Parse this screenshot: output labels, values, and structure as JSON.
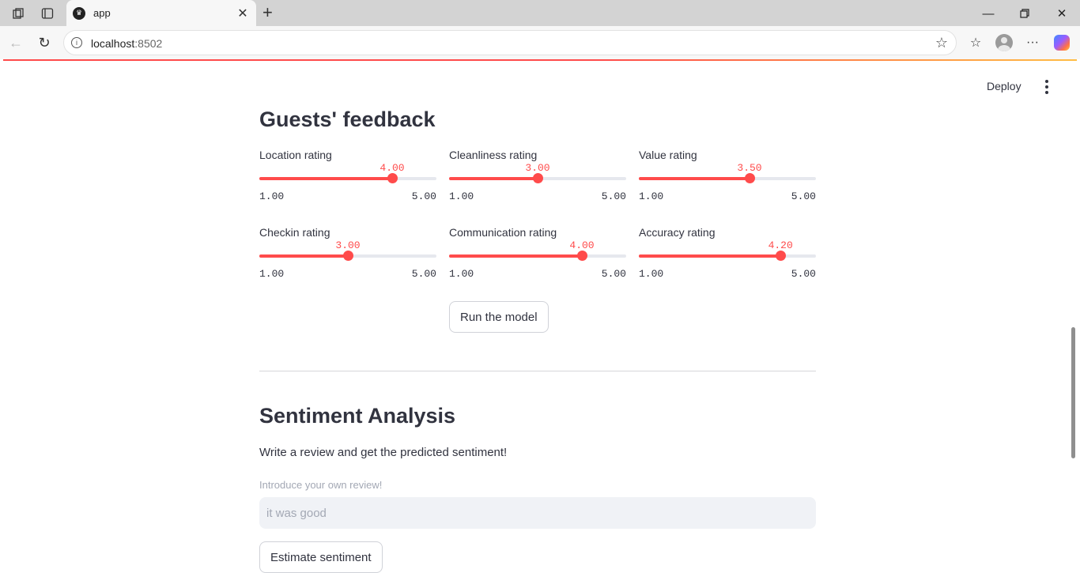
{
  "browser": {
    "tab_title": "app",
    "url_host": "localhost",
    "url_port": ":8502"
  },
  "header": {
    "deploy_label": "Deploy"
  },
  "feedback": {
    "title": "Guests' feedback",
    "sliders": [
      {
        "label": "Location rating",
        "value": "4.00",
        "min": "1.00",
        "max": "5.00",
        "fraction": 0.75
      },
      {
        "label": "Cleanliness rating",
        "value": "3.00",
        "min": "1.00",
        "max": "5.00",
        "fraction": 0.5
      },
      {
        "label": "Value rating",
        "value": "3.50",
        "min": "1.00",
        "max": "5.00",
        "fraction": 0.625
      },
      {
        "label": "Checkin rating",
        "value": "3.00",
        "min": "1.00",
        "max": "5.00",
        "fraction": 0.5
      },
      {
        "label": "Communication rating",
        "value": "4.00",
        "min": "1.00",
        "max": "5.00",
        "fraction": 0.75
      },
      {
        "label": "Accuracy rating",
        "value": "4.20",
        "min": "1.00",
        "max": "5.00",
        "fraction": 0.8
      }
    ],
    "run_button": "Run the model"
  },
  "sentiment": {
    "title": "Sentiment Analysis",
    "description": "Write a review and get the predicted sentiment!",
    "input_label": "Introduce your own review!",
    "input_value": "it was good",
    "estimate_button": "Estimate sentiment"
  },
  "colors": {
    "accent": "#ff4b4b",
    "text": "#31333f"
  }
}
